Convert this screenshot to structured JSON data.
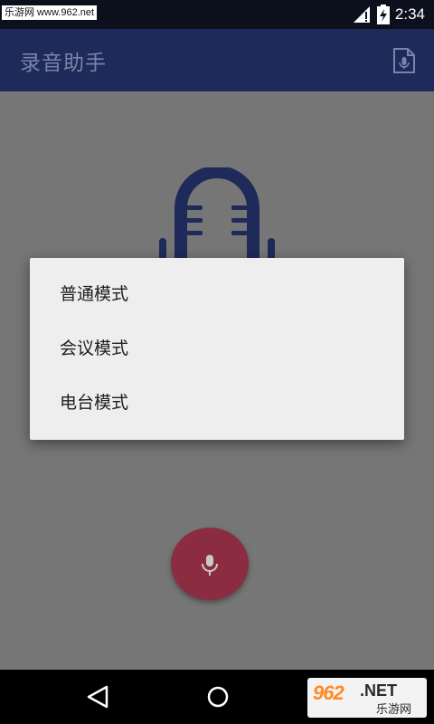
{
  "status_bar": {
    "watermark": "乐游网 www.962.net",
    "time": "2:34"
  },
  "app_bar": {
    "title": "录音助手",
    "action_icon": "file-mic-icon"
  },
  "dialog": {
    "items": [
      "普通模式",
      "会议模式",
      "电台模式"
    ]
  },
  "fab": {
    "icon": "mic-icon"
  },
  "nav_bar": {
    "watermark_num": "962",
    "watermark_net": ".NET",
    "watermark_cn": "乐游网"
  },
  "colors": {
    "app_bar": "#1e2a5a",
    "overlay_bg": "#767676",
    "fab": "#8c2c41",
    "dialog": "#eeeeee"
  }
}
